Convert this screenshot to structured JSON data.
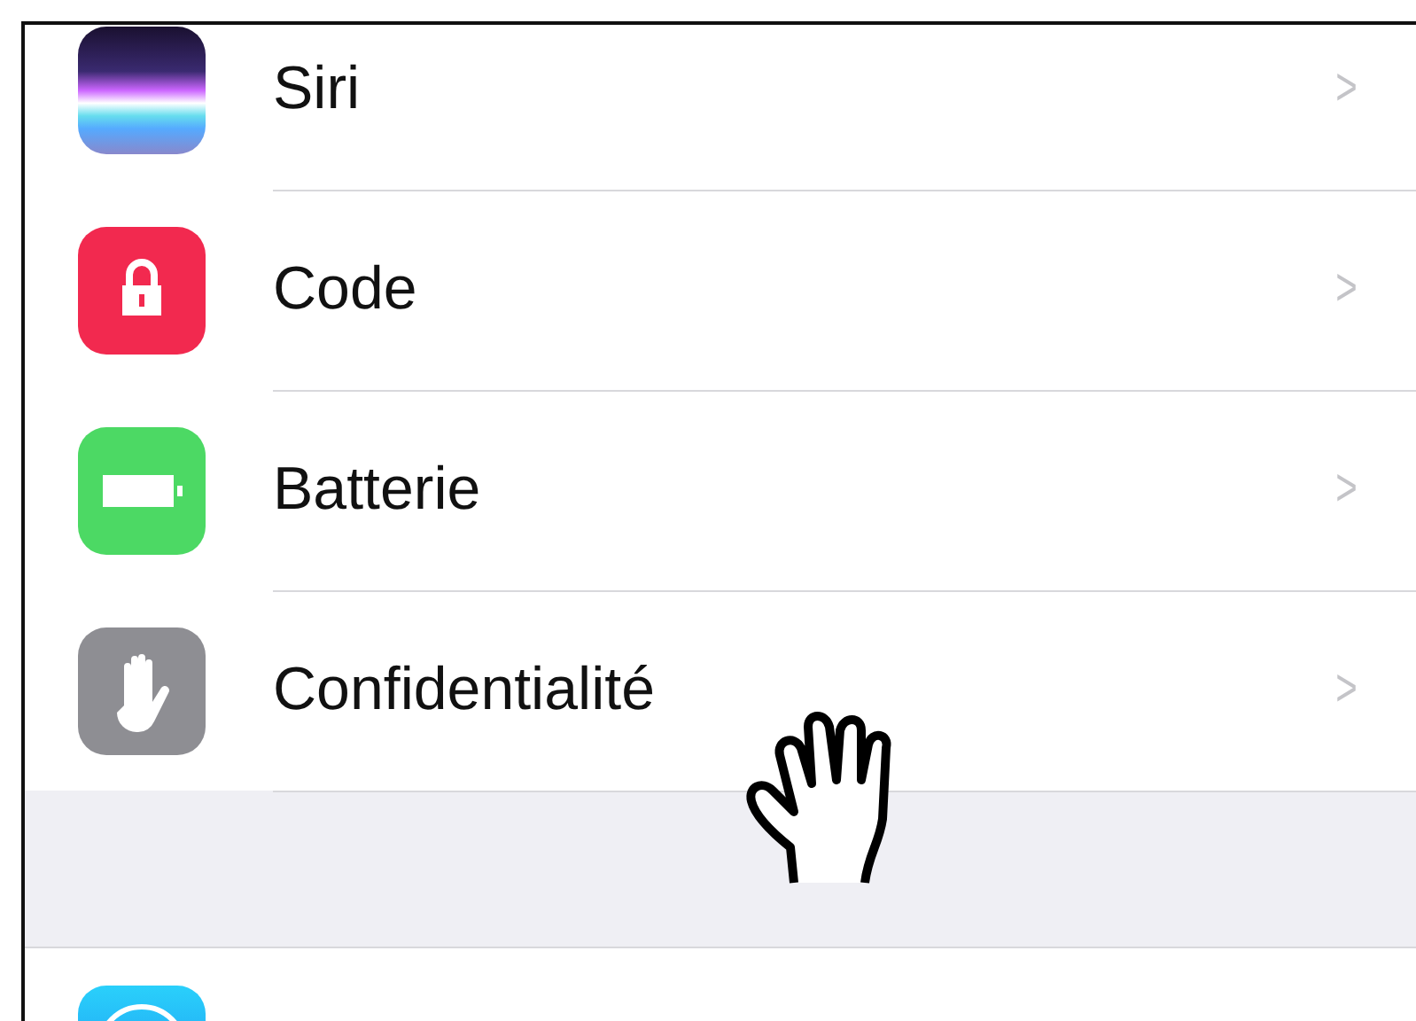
{
  "settings_group": [
    {
      "kind": "siri",
      "label": "Siri"
    },
    {
      "kind": "lock",
      "label": "Code"
    },
    {
      "kind": "battery",
      "label": "Batterie"
    },
    {
      "kind": "hand",
      "label": "Confidentialité"
    }
  ],
  "chevron": ">",
  "next_group": [
    {
      "kind": "store"
    }
  ]
}
